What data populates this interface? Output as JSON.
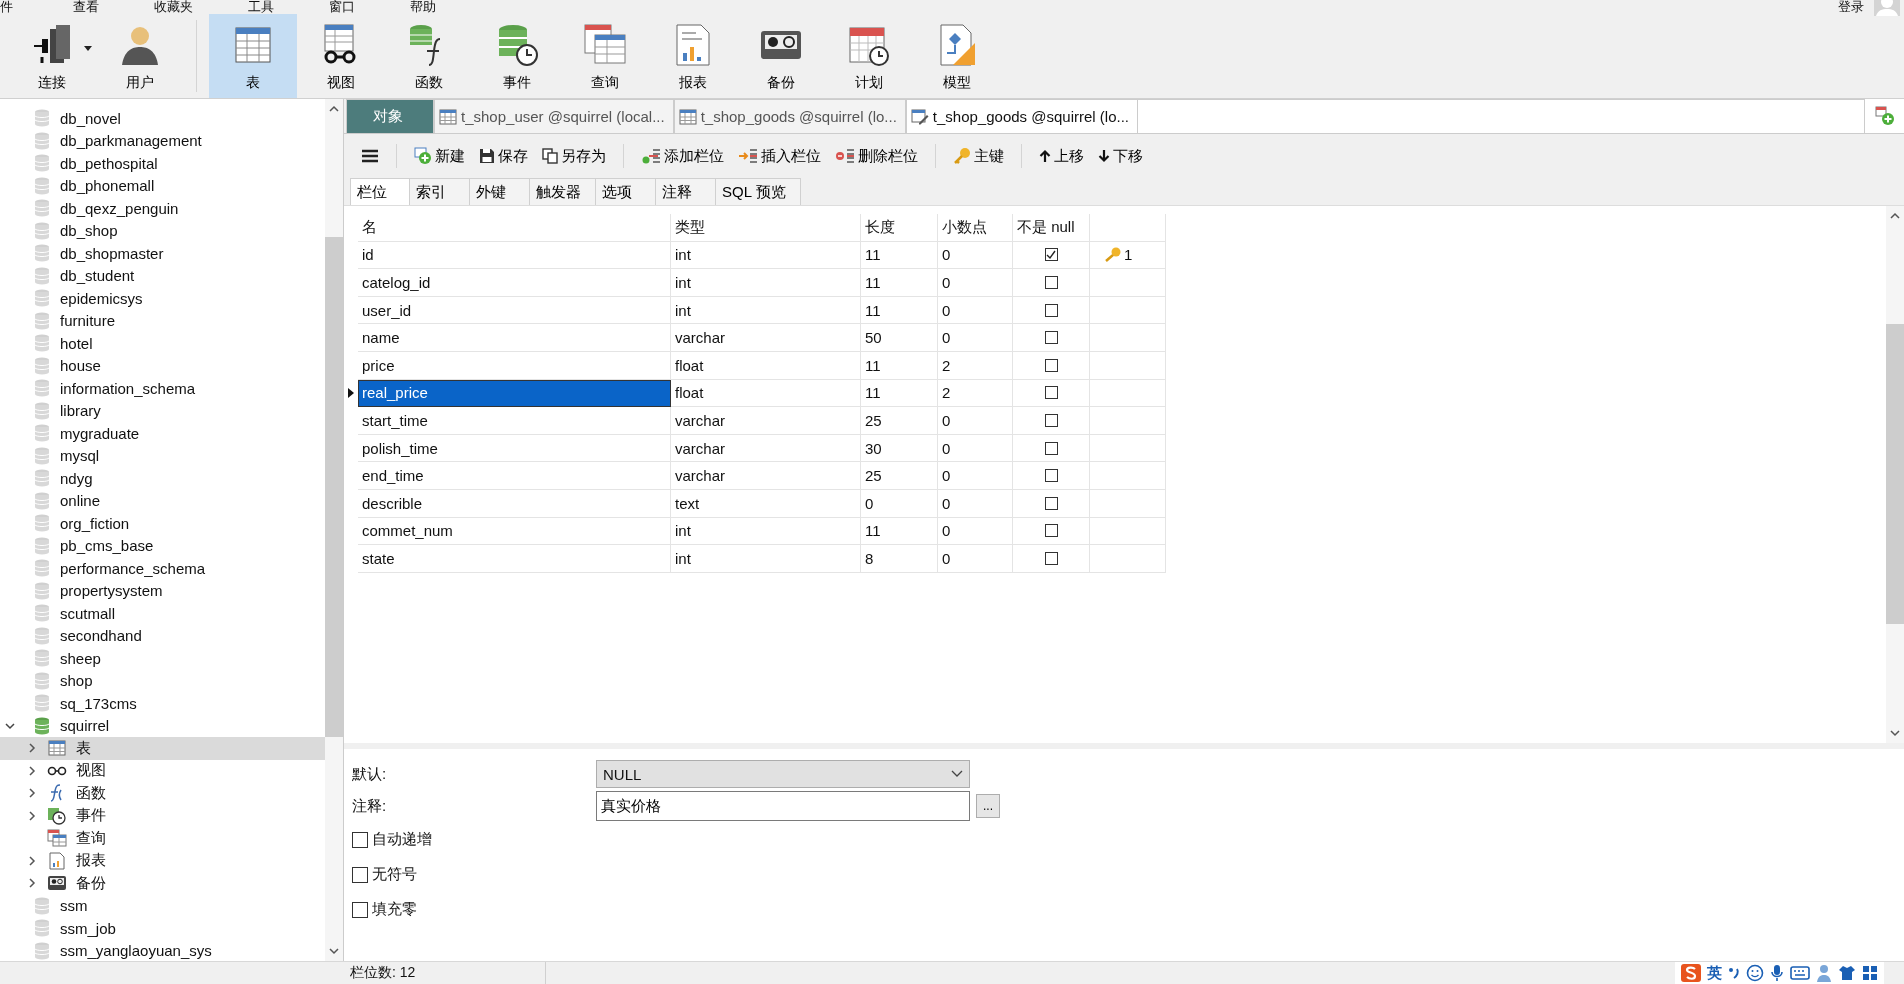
{
  "menu": [
    {
      "label": "件"
    },
    {
      "label": "查看"
    },
    {
      "label": "收藏夹"
    },
    {
      "label": "工具"
    },
    {
      "label": "窗口"
    },
    {
      "label": "帮助"
    }
  ],
  "account": {
    "label": "登录"
  },
  "toolbar": [
    {
      "label": "连接",
      "kind": "connect",
      "selected": false
    },
    {
      "label": "用户",
      "kind": "user",
      "selected": false
    },
    {
      "label": "表",
      "kind": "table",
      "selected": true
    },
    {
      "label": "视图",
      "kind": "view",
      "selected": false
    },
    {
      "label": "函数",
      "kind": "function",
      "selected": false
    },
    {
      "label": "事件",
      "kind": "event",
      "selected": false
    },
    {
      "label": "查询",
      "kind": "query",
      "selected": false
    },
    {
      "label": "报表",
      "kind": "report",
      "selected": false
    },
    {
      "label": "备份",
      "kind": "backup",
      "selected": false
    },
    {
      "label": "计划",
      "kind": "schedule",
      "selected": false
    },
    {
      "label": "模型",
      "kind": "model",
      "selected": false
    }
  ],
  "sidebar": {
    "items": [
      {
        "label": "db_novel",
        "kind": "db",
        "open": false
      },
      {
        "label": "db_parkmanagement",
        "kind": "db",
        "open": false
      },
      {
        "label": "db_pethospital",
        "kind": "db",
        "open": false
      },
      {
        "label": "db_phonemall",
        "kind": "db",
        "open": false
      },
      {
        "label": "db_qexz_penguin",
        "kind": "db",
        "open": false
      },
      {
        "label": "db_shop",
        "kind": "db",
        "open": false
      },
      {
        "label": "db_shopmaster",
        "kind": "db",
        "open": false
      },
      {
        "label": "db_student",
        "kind": "db",
        "open": false
      },
      {
        "label": "epidemicsys",
        "kind": "db",
        "open": false
      },
      {
        "label": "furniture",
        "kind": "db",
        "open": false
      },
      {
        "label": "hotel",
        "kind": "db",
        "open": false
      },
      {
        "label": "house",
        "kind": "db",
        "open": false
      },
      {
        "label": "information_schema",
        "kind": "db",
        "open": false
      },
      {
        "label": "library",
        "kind": "db",
        "open": false
      },
      {
        "label": "mygraduate",
        "kind": "db",
        "open": false
      },
      {
        "label": "mysql",
        "kind": "db",
        "open": false
      },
      {
        "label": "ndyg",
        "kind": "db",
        "open": false
      },
      {
        "label": "online",
        "kind": "db",
        "open": false
      },
      {
        "label": "org_fiction",
        "kind": "db",
        "open": false
      },
      {
        "label": "pb_cms_base",
        "kind": "db",
        "open": false
      },
      {
        "label": "performance_schema",
        "kind": "db",
        "open": false
      },
      {
        "label": "propertysystem",
        "kind": "db",
        "open": false
      },
      {
        "label": "scutmall",
        "kind": "db",
        "open": false
      },
      {
        "label": "secondhand",
        "kind": "db",
        "open": false
      },
      {
        "label": "sheep",
        "kind": "db",
        "open": false
      },
      {
        "label": "shop",
        "kind": "db",
        "open": false
      },
      {
        "label": "sq_173cms",
        "kind": "db",
        "open": false
      },
      {
        "label": "squirrel",
        "kind": "db",
        "open": true,
        "expanded": true,
        "children": [
          {
            "label": "表",
            "kind": "table",
            "selected": true,
            "expandable": true
          },
          {
            "label": "视图",
            "kind": "view",
            "selected": false,
            "expandable": true
          },
          {
            "label": "函数",
            "kind": "function",
            "selected": false,
            "expandable": true
          },
          {
            "label": "事件",
            "kind": "event",
            "selected": false,
            "expandable": true
          },
          {
            "label": "查询",
            "kind": "query",
            "selected": false,
            "expandable": false
          },
          {
            "label": "报表",
            "kind": "report",
            "selected": false,
            "expandable": true
          },
          {
            "label": "备份",
            "kind": "backup",
            "selected": false,
            "expandable": true
          }
        ]
      },
      {
        "label": "ssm",
        "kind": "db",
        "open": false
      },
      {
        "label": "ssm_job",
        "kind": "db",
        "open": false
      },
      {
        "label": "ssm_yanglaoyuan_sys",
        "kind": "db",
        "open": false
      }
    ]
  },
  "editor_tabs": [
    {
      "label": "对象",
      "kind": "objects",
      "selected": false
    },
    {
      "label": "t_shop_user @squirrel (local...",
      "kind": "table",
      "selected": false
    },
    {
      "label": "t_shop_goods @squirrel (lo...",
      "kind": "table",
      "selected": false
    },
    {
      "label": "t_shop_goods @squirrel (lo...",
      "kind": "design",
      "selected": true
    }
  ],
  "actions": [
    {
      "label": "新建",
      "kind": "new"
    },
    {
      "label": "保存",
      "kind": "save"
    },
    {
      "label": "另存为",
      "kind": "save_as"
    },
    {
      "label": "添加栏位",
      "kind": "add_field"
    },
    {
      "label": "插入栏位",
      "kind": "insert_field"
    },
    {
      "label": "删除栏位",
      "kind": "delete_field"
    },
    {
      "label": "主键",
      "kind": "primary_key"
    },
    {
      "label": "上移",
      "kind": "up"
    },
    {
      "label": "下移",
      "kind": "down"
    }
  ],
  "design_tabs": [
    {
      "label": "栏位",
      "selected": true
    },
    {
      "label": "索引",
      "selected": false
    },
    {
      "label": "外键",
      "selected": false
    },
    {
      "label": "触发器",
      "selected": false
    },
    {
      "label": "选项",
      "selected": false
    },
    {
      "label": "注释",
      "selected": false
    },
    {
      "label": "SQL 预览",
      "selected": false
    }
  ],
  "table": {
    "columns": [
      "名",
      "类型",
      "长度",
      "小数点",
      "不是 null"
    ],
    "rows": [
      {
        "name": "id",
        "type": "int",
        "length": "11",
        "decimals": "0",
        "not_null": true,
        "key": "1",
        "selected": false
      },
      {
        "name": "catelog_id",
        "type": "int",
        "length": "11",
        "decimals": "0",
        "not_null": false,
        "selected": false
      },
      {
        "name": "user_id",
        "type": "int",
        "length": "11",
        "decimals": "0",
        "not_null": false,
        "selected": false
      },
      {
        "name": "name",
        "type": "varchar",
        "length": "50",
        "decimals": "0",
        "not_null": false,
        "selected": false
      },
      {
        "name": "price",
        "type": "float",
        "length": "11",
        "decimals": "2",
        "not_null": false,
        "selected": false
      },
      {
        "name": "real_price",
        "type": "float",
        "length": "11",
        "decimals": "2",
        "not_null": false,
        "selected": true
      },
      {
        "name": "start_time",
        "type": "varchar",
        "length": "25",
        "decimals": "0",
        "not_null": false,
        "selected": false
      },
      {
        "name": "polish_time",
        "type": "varchar",
        "length": "30",
        "decimals": "0",
        "not_null": false,
        "selected": false
      },
      {
        "name": "end_time",
        "type": "varchar",
        "length": "25",
        "decimals": "0",
        "not_null": false,
        "selected": false
      },
      {
        "name": "describle",
        "type": "text",
        "length": "0",
        "decimals": "0",
        "not_null": false,
        "selected": false
      },
      {
        "name": "commet_num",
        "type": "int",
        "length": "11",
        "decimals": "0",
        "not_null": false,
        "selected": false
      },
      {
        "name": "state",
        "type": "int",
        "length": "8",
        "decimals": "0",
        "not_null": false,
        "selected": false
      }
    ]
  },
  "properties": {
    "default": {
      "label": "默认:",
      "value": "NULL"
    },
    "comment": {
      "label": "注释:",
      "value": "真实价格",
      "button": "..."
    },
    "options": [
      {
        "label": "自动递增",
        "checked": false
      },
      {
        "label": "无符号",
        "checked": false
      },
      {
        "label": "填充零",
        "checked": false
      }
    ]
  },
  "status_bar": {
    "text": "栏位数: 12"
  },
  "ime": {
    "label": "英"
  }
}
